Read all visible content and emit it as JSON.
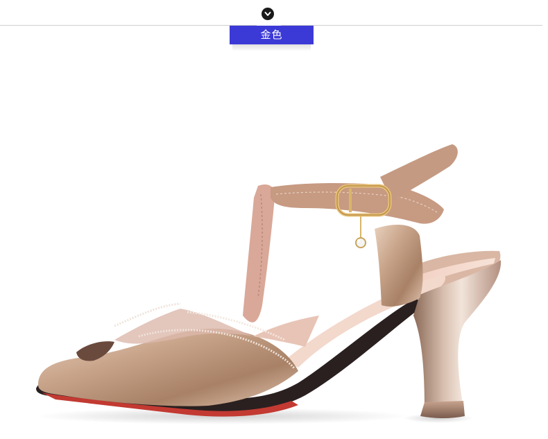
{
  "header": {
    "color_label": "金色",
    "badge_icon": "chevron-down-icon"
  },
  "product": {
    "type": "t-strap-sandal",
    "icon": "sandal-image"
  },
  "colors": {
    "accent": "#3c3ad6",
    "divider": "#cfcfcf",
    "badge": "#1a1a1a",
    "sandal_gold": "#c9a58b",
    "sandal_pink": "#e3b2a6"
  }
}
